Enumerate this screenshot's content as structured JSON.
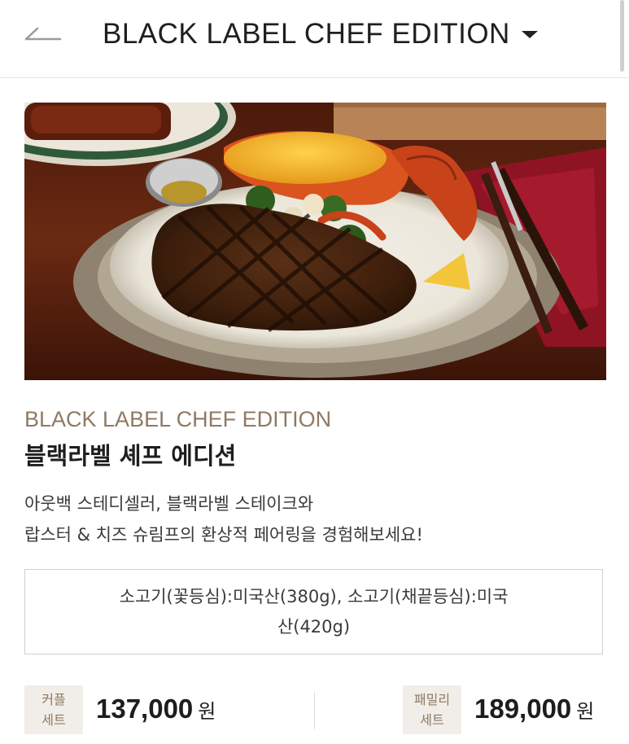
{
  "header": {
    "title": "BLACK LABEL CHEF EDITION"
  },
  "product": {
    "name_en": "BLACK LABEL CHEF EDITION",
    "name_ko": "블랙라벨 셰프 에디션",
    "description_lines": [
      "아웃백 스테디셀러, 블랙라벨 스테이크와",
      "랍스터 & 치즈 슈림프의 환상적 페어링을 경험해보세요!"
    ],
    "origin_lines": [
      "소고기(꽃등심):미국산(380g), 소고기(채끝등심):미국",
      "산(420g)"
    ]
  },
  "prices": [
    {
      "badge_lines": [
        "커플",
        "세트"
      ],
      "amount": "137,000",
      "unit": "원"
    },
    {
      "badge_lines": [
        "패밀리",
        "세트"
      ],
      "amount": "189,000",
      "unit": "원"
    }
  ],
  "colors": {
    "accent": "#8f7a63",
    "badge_bg": "#f1ede8",
    "text": "#222222"
  },
  "icons": {
    "back": "back-arrow-icon",
    "dropdown": "caret-down-icon"
  }
}
